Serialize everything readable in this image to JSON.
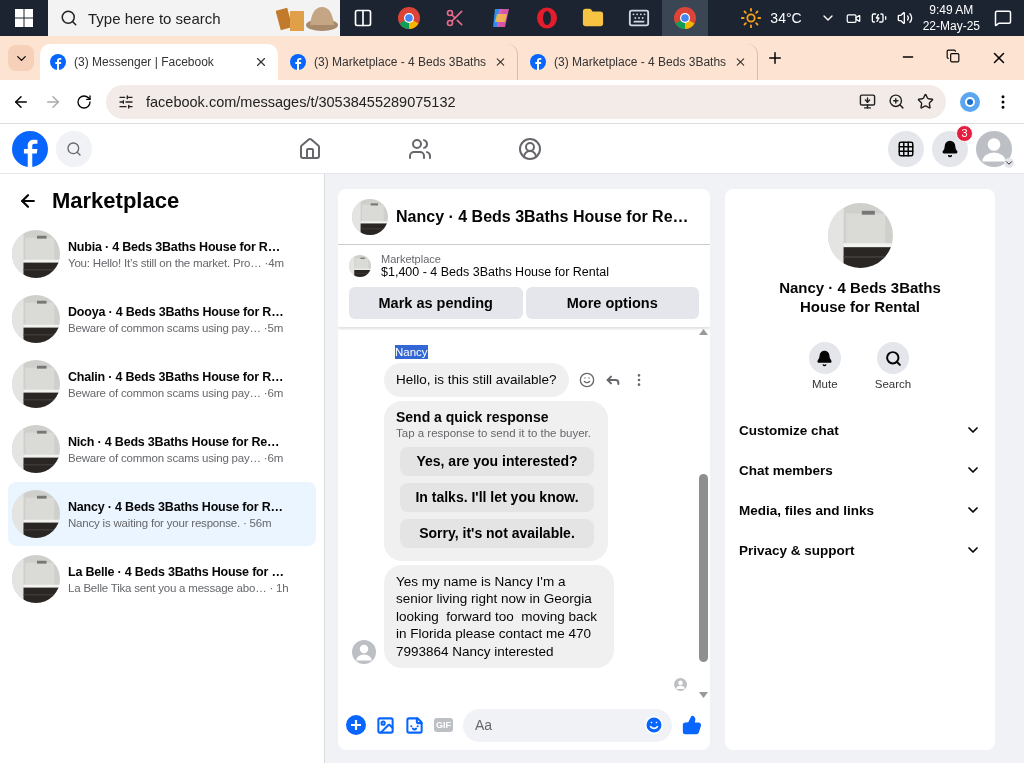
{
  "taskbar": {
    "search_placeholder": "Type here to search",
    "apps": [
      {
        "kind": "taskview",
        "selected": false
      },
      {
        "kind": "chrome",
        "selected": false
      },
      {
        "kind": "snip",
        "selected": false
      },
      {
        "kind": "copilot",
        "selected": false
      },
      {
        "kind": "opera",
        "selected": false
      },
      {
        "kind": "explorer",
        "selected": false
      },
      {
        "kind": "keyboard",
        "selected": false
      },
      {
        "kind": "chrome",
        "selected": true
      }
    ],
    "temperature": "34°C",
    "time": "9:49 AM",
    "date": "22-May-25"
  },
  "browser": {
    "tabs": [
      {
        "title": "(3) Messenger | Facebook",
        "selected": true
      },
      {
        "title": "(3) Marketplace - 4 Beds 3Baths",
        "selected": false
      },
      {
        "title": "(3) Marketplace - 4 Beds 3Baths",
        "selected": false
      }
    ],
    "url": "facebook.com/messages/t/30538455289075132"
  },
  "header": {
    "notification_count": "3"
  },
  "sidebar": {
    "title": "Marketplace",
    "conversations": [
      {
        "name": "Nubia · 4 Beds 3Baths House for R…",
        "preview": "You: Hello! It’s still on the market. Pro…",
        "time": "·4m",
        "selected": false
      },
      {
        "name": "Dooya · 4 Beds 3Baths House for R…",
        "preview": "Beware of common scams using pay…",
        "time": "·5m",
        "selected": false
      },
      {
        "name": "Chalin · 4 Beds 3Baths House for R…",
        "preview": "Beware of common scams using pay…",
        "time": "·6m",
        "selected": false
      },
      {
        "name": "Nich · 4 Beds 3Baths House for Re…",
        "preview": "Beware of common scams using pay…",
        "time": "·6m",
        "selected": false
      },
      {
        "name": "Nancy · 4 Beds 3Baths House for R…",
        "preview": "Nancy is waiting for your response.",
        "time": "· 56m",
        "selected": true
      },
      {
        "name": "La Belle · 4 Beds 3Baths House for …",
        "preview": "La Belle Tika sent you a message abo…",
        "time": "· 1h",
        "selected": false
      }
    ]
  },
  "chat": {
    "title": "Nancy · 4 Beds 3Baths House for Re…",
    "listing": {
      "label": "Marketplace",
      "summary": "$1,400 - 4 Beds 3Baths House for Rental"
    },
    "actions": [
      "Mark as pending",
      "More options"
    ],
    "sender": {
      "name": "Nancy",
      "highlighted": true
    },
    "messages": [
      {
        "kind": "text",
        "text": "Hello, is this still available?"
      },
      {
        "kind": "quick_responses",
        "title": "Send a quick response",
        "subtitle": "Tap a response to send it to the buyer.",
        "options": [
          "Yes, are you interested?",
          "In talks. I'll let you know.",
          "Sorry, it's not available."
        ]
      },
      {
        "kind": "text",
        "text": "Yes my name is Nancy I'm a senior living right now in Georgia looking  forward too  moving back in Florida please contact me 470 7993864 Nancy interested"
      }
    ],
    "composer": {
      "gif": "GIF",
      "placeholder": "Aa"
    }
  },
  "details": {
    "title": "Nancy · 4 Beds 3Baths House for Rental",
    "actions": [
      {
        "kind": "mute",
        "label": "Mute"
      },
      {
        "kind": "search",
        "label": "Search"
      }
    ],
    "sections": [
      "Customize chat",
      "Chat members",
      "Media, files and links",
      "Privacy & support"
    ]
  }
}
